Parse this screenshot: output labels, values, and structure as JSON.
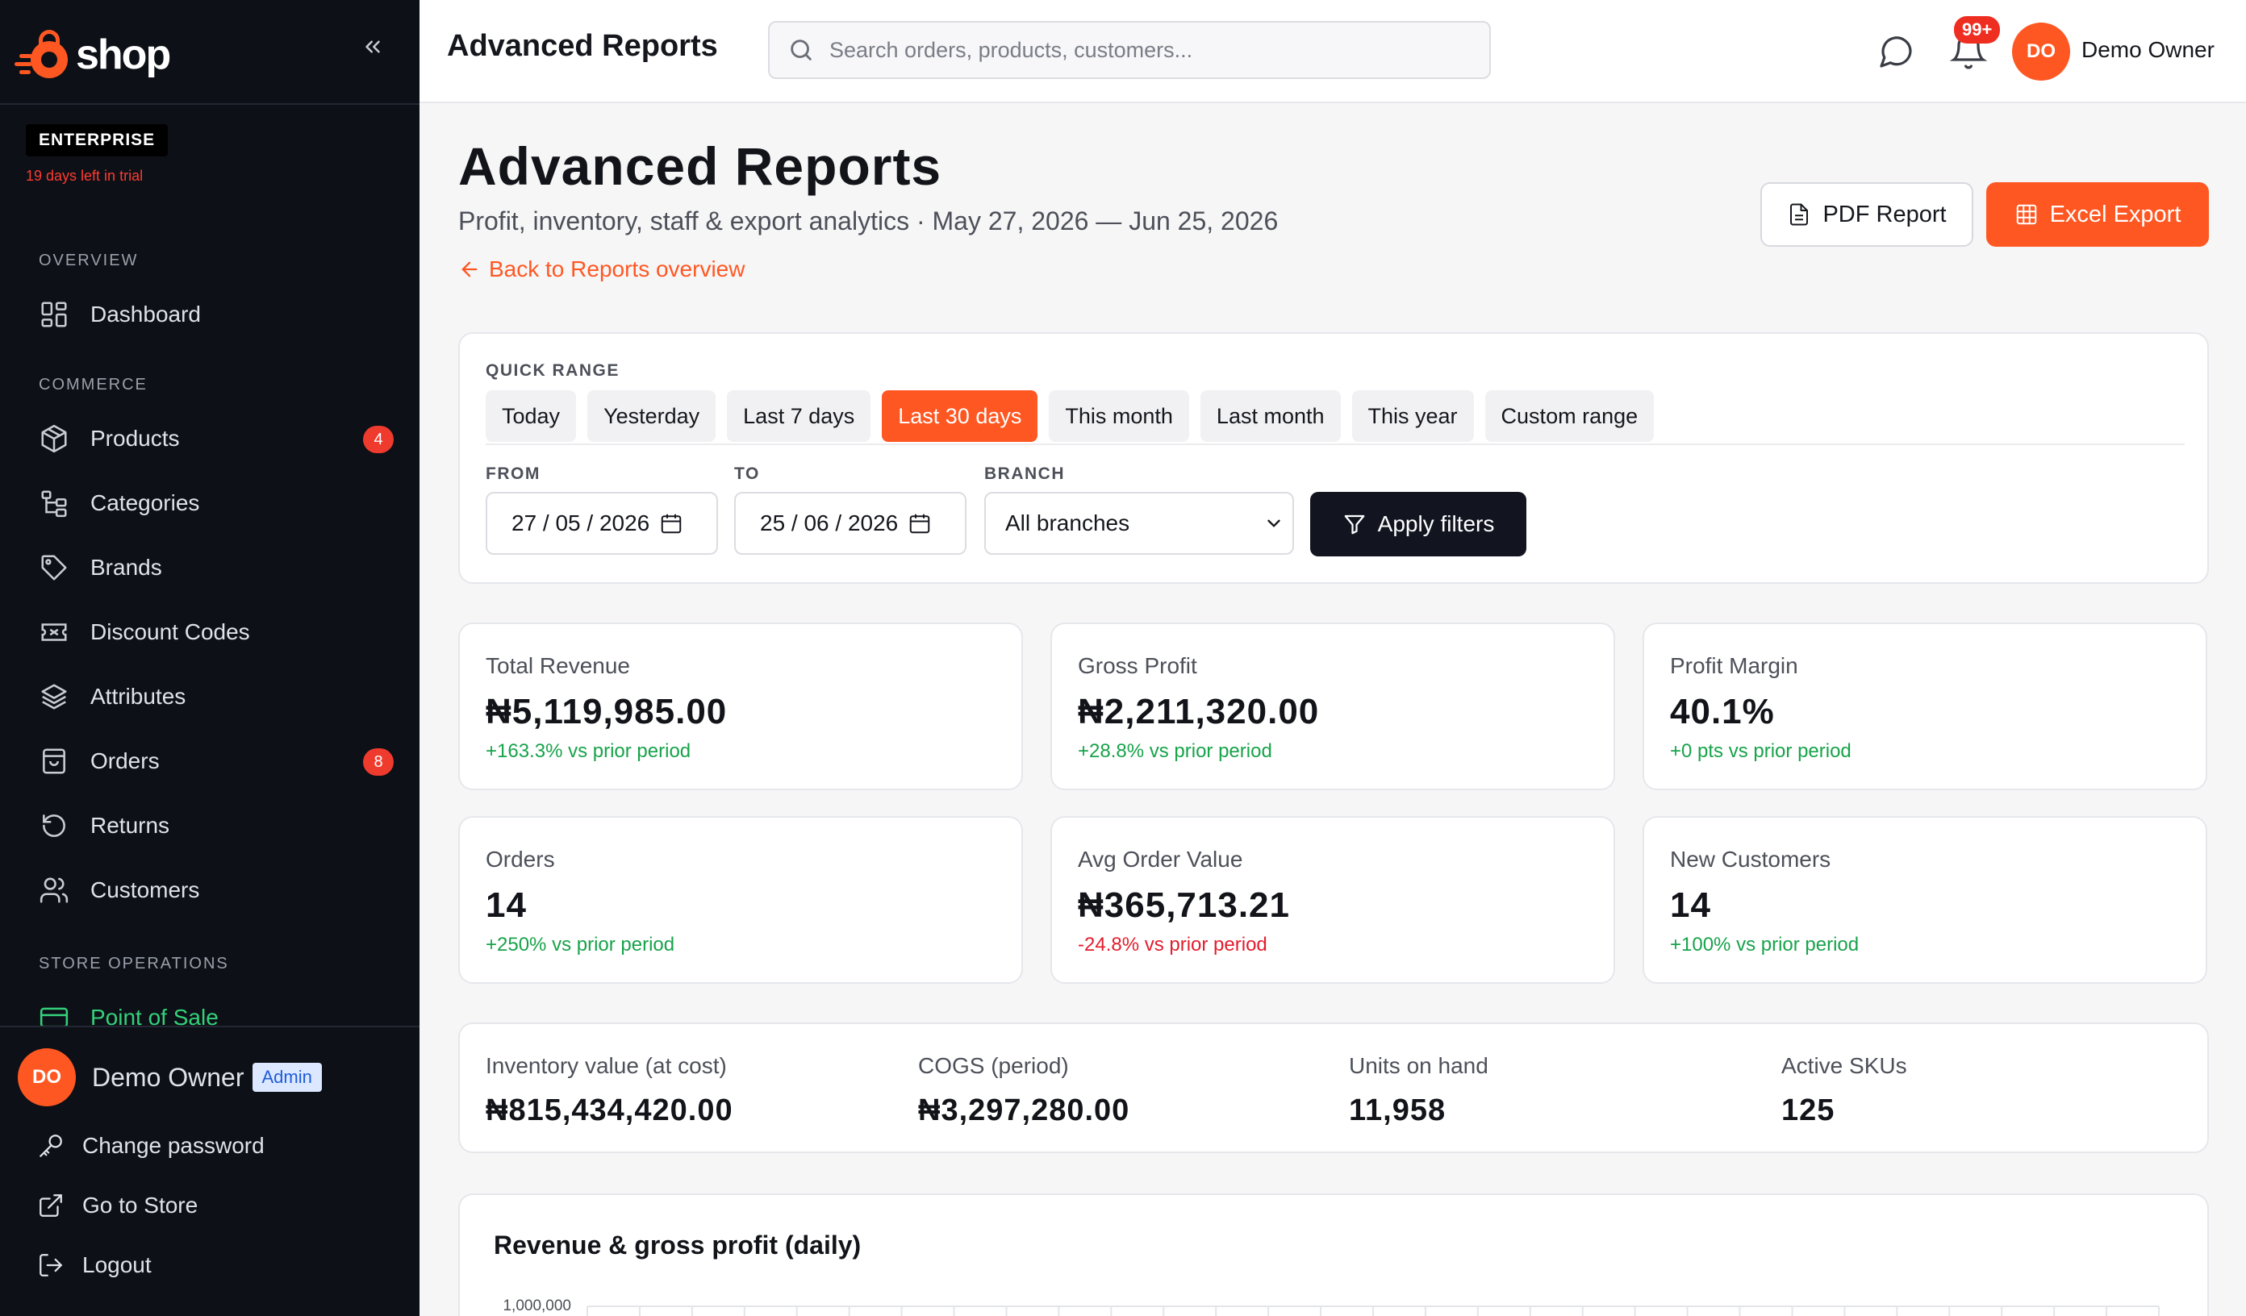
{
  "brand": {
    "name": "shop",
    "accent": "#ff5722"
  },
  "sidebar": {
    "plan": "ENTERPRISE",
    "trial": "19 days left in trial",
    "sections": {
      "overview": "OVERVIEW",
      "commerce": "COMMERCE",
      "store_ops": "STORE OPERATIONS"
    },
    "items": [
      {
        "label": "Dashboard",
        "icon": "grid-icon"
      },
      {
        "label": "Products",
        "icon": "box-icon",
        "badge": "4"
      },
      {
        "label": "Categories",
        "icon": "tree-icon"
      },
      {
        "label": "Brands",
        "icon": "tag-icon"
      },
      {
        "label": "Discount Codes",
        "icon": "ticket-icon"
      },
      {
        "label": "Attributes",
        "icon": "layers-icon"
      },
      {
        "label": "Orders",
        "icon": "bag-icon",
        "badge": "8"
      },
      {
        "label": "Returns",
        "icon": "return-icon"
      },
      {
        "label": "Customers",
        "icon": "users-icon"
      },
      {
        "label": "Point of Sale",
        "icon": "card-icon"
      }
    ],
    "user": {
      "initials": "DO",
      "name": "Demo Owner",
      "role": "Admin"
    },
    "footer_links": [
      {
        "label": "Change password",
        "icon": "key-icon"
      },
      {
        "label": "Go to Store",
        "icon": "external-link-icon"
      },
      {
        "label": "Logout",
        "icon": "logout-icon"
      }
    ]
  },
  "topbar": {
    "title": "Advanced Reports",
    "search_placeholder": "Search orders, products, customers...",
    "notif_count": "99+",
    "user_initials": "DO",
    "user_name": "Demo Owner"
  },
  "page": {
    "title": "Advanced Reports",
    "subtitle": "Profit, inventory, staff & export analytics · May 27, 2026 — Jun 25, 2026",
    "back_link": "Back to Reports overview",
    "pdf_button": "PDF Report",
    "excel_button": "Excel Export"
  },
  "filters": {
    "quick_range_label": "QUICK RANGE",
    "ranges": [
      "Today",
      "Yesterday",
      "Last 7 days",
      "Last 30 days",
      "This month",
      "Last month",
      "This year",
      "Custom range"
    ],
    "active_range": "Last 30 days",
    "from_label": "FROM",
    "from_value": "27 / 05 / 2026",
    "to_label": "TO",
    "to_value": "25 / 06 / 2026",
    "branch_label": "BRANCH",
    "branch_value": "All branches",
    "apply_label": "Apply filters"
  },
  "kpis": [
    {
      "label": "Total Revenue",
      "value": "₦5,119,985.00",
      "delta": "+163.3% vs prior period",
      "trend": "up"
    },
    {
      "label": "Gross Profit",
      "value": "₦2,211,320.00",
      "delta": "+28.8% vs prior period",
      "trend": "up"
    },
    {
      "label": "Profit Margin",
      "value": "40.1%",
      "delta": "+0 pts vs prior period",
      "trend": "up"
    },
    {
      "label": "Orders",
      "value": "14",
      "delta": "+250% vs prior period",
      "trend": "up"
    },
    {
      "label": "Avg Order Value",
      "value": "₦365,713.21",
      "delta": "-24.8% vs prior period",
      "trend": "down"
    },
    {
      "label": "New Customers",
      "value": "14",
      "delta": "+100% vs prior period",
      "trend": "up"
    }
  ],
  "inventory": [
    {
      "label": "Inventory value (at cost)",
      "value": "₦815,434,420.00"
    },
    {
      "label": "COGS (period)",
      "value": "₦3,297,280.00"
    },
    {
      "label": "Units on hand",
      "value": "11,958"
    },
    {
      "label": "Active SKUs",
      "value": "125"
    }
  ],
  "chart": {
    "title": "Revenue & gross profit (daily)",
    "y_tick_top": "1,000,000"
  },
  "chart_data": {
    "type": "line",
    "title": "Revenue & gross profit (daily)",
    "y_ticks": [
      "1,000,000"
    ],
    "ylim_top": 1000000,
    "x_count": 30,
    "grid": true
  }
}
